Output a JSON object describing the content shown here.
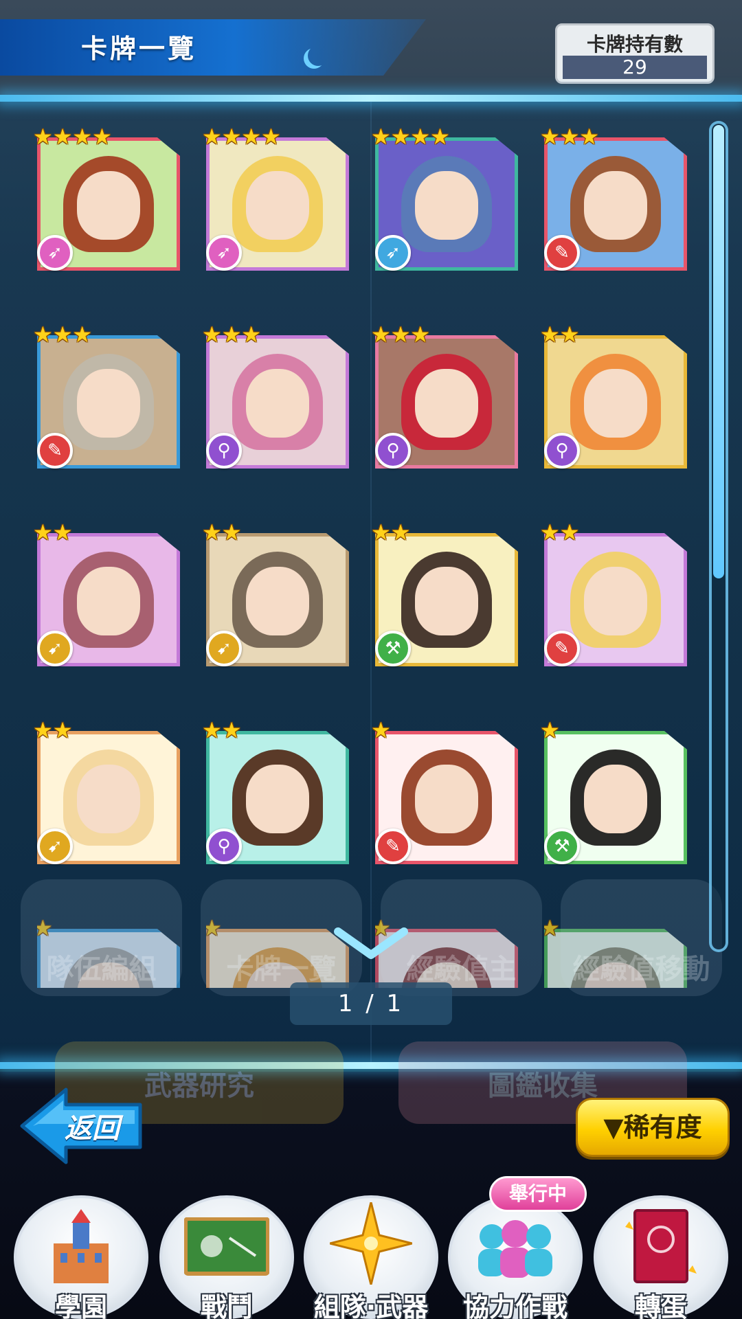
{
  "header": {
    "title": "卡牌一覽",
    "count_label": "卡牌持有數",
    "count_value": "29"
  },
  "cards": [
    {
      "stars": 4,
      "type": "gun-pink",
      "frame": "#e8556a",
      "bg": "#c8e8a0",
      "hair": "#a54a2a"
    },
    {
      "stars": 4,
      "type": "gun-pink",
      "frame": "#c47ad8",
      "bg": "#f0e8c0",
      "hair": "#f2d060"
    },
    {
      "stars": 4,
      "type": "gun-blue",
      "frame": "#3fb8a0",
      "bg": "#6a60c8",
      "hair": "#5a7ab8"
    },
    {
      "stars": 3,
      "type": "sword",
      "frame": "#e8556a",
      "bg": "#7ab0e8",
      "hair": "#9a5a38"
    },
    {
      "stars": 3,
      "type": "sword",
      "frame": "#3a9ad8",
      "bg": "#c8b090",
      "hair": "#c0b8a8"
    },
    {
      "stars": 3,
      "type": "wand",
      "frame": "#c47ad8",
      "bg": "#e8d0d8",
      "hair": "#d880a8"
    },
    {
      "stars": 3,
      "type": "wand",
      "frame": "#e87aa0",
      "bg": "#a87868",
      "hair": "#c8283a"
    },
    {
      "stars": 2,
      "type": "wand",
      "frame": "#e8b838",
      "bg": "#f0d890",
      "hair": "#f09040"
    },
    {
      "stars": 2,
      "type": "spear",
      "frame": "#c47ad8",
      "bg": "#e8b8e8",
      "hair": "#a86070"
    },
    {
      "stars": 2,
      "type": "spear",
      "frame": "#b89a70",
      "bg": "#e8d8b8",
      "hair": "#7a6a58"
    },
    {
      "stars": 2,
      "type": "hammer",
      "frame": "#e8b838",
      "bg": "#f8f0c0",
      "hair": "#4a3a30"
    },
    {
      "stars": 2,
      "type": "sword",
      "frame": "#c47ad8",
      "bg": "#e8c8f0",
      "hair": "#f0d070"
    },
    {
      "stars": 2,
      "type": "spear",
      "frame": "#e8a060",
      "bg": "#fff4d8",
      "hair": "#f4d8a0"
    },
    {
      "stars": 2,
      "type": "wand",
      "frame": "#40b8a0",
      "bg": "#b8f0e8",
      "hair": "#5a3a28"
    },
    {
      "stars": 1,
      "type": "sword",
      "frame": "#e8556a",
      "bg": "#fff0f0",
      "hair": "#9a4a30"
    },
    {
      "stars": 1,
      "type": "hammer",
      "frame": "#58c060",
      "bg": "#f0fff0",
      "hair": "#2a2a28"
    },
    {
      "stars": 1,
      "type": "none",
      "frame": "#3a9ad8",
      "bg": "#e0f0ff",
      "hair": "#a8a8a8"
    },
    {
      "stars": 1,
      "type": "none",
      "frame": "#e8a060",
      "bg": "#fff0d8",
      "hair": "#e8a040"
    },
    {
      "stars": 1,
      "type": "none",
      "frame": "#e8556a",
      "bg": "#fff0f0",
      "hair": "#8a3a3a"
    },
    {
      "stars": 1,
      "type": "none",
      "frame": "#58c060",
      "bg": "#f0fff0",
      "hair": "#8a8a70"
    }
  ],
  "ghost_menu": [
    "隊伍編組",
    "卡牌一覽",
    "經驗值主",
    "經驗值移動"
  ],
  "ghost_menu2": [
    "武器研究",
    "圖鑑收集"
  ],
  "pager": "1 / 1",
  "controls": {
    "back_label": "返回",
    "sort_label": "▼稀有度"
  },
  "nav": {
    "items": [
      "學園",
      "戰鬥",
      "組隊·武器",
      "協力作戰",
      "轉蛋"
    ],
    "badge": "舉行中"
  },
  "type_icons": {
    "gun-pink": {
      "glyph": "➶",
      "color": "#e060c0"
    },
    "gun-blue": {
      "glyph": "➶",
      "color": "#40a8e0"
    },
    "sword": {
      "glyph": "✎",
      "color": "#e04040"
    },
    "wand": {
      "glyph": "⚲",
      "color": "#9050d0"
    },
    "spear": {
      "glyph": "➹",
      "color": "#e0a820"
    },
    "hammer": {
      "glyph": "⚒",
      "color": "#40b048"
    }
  }
}
